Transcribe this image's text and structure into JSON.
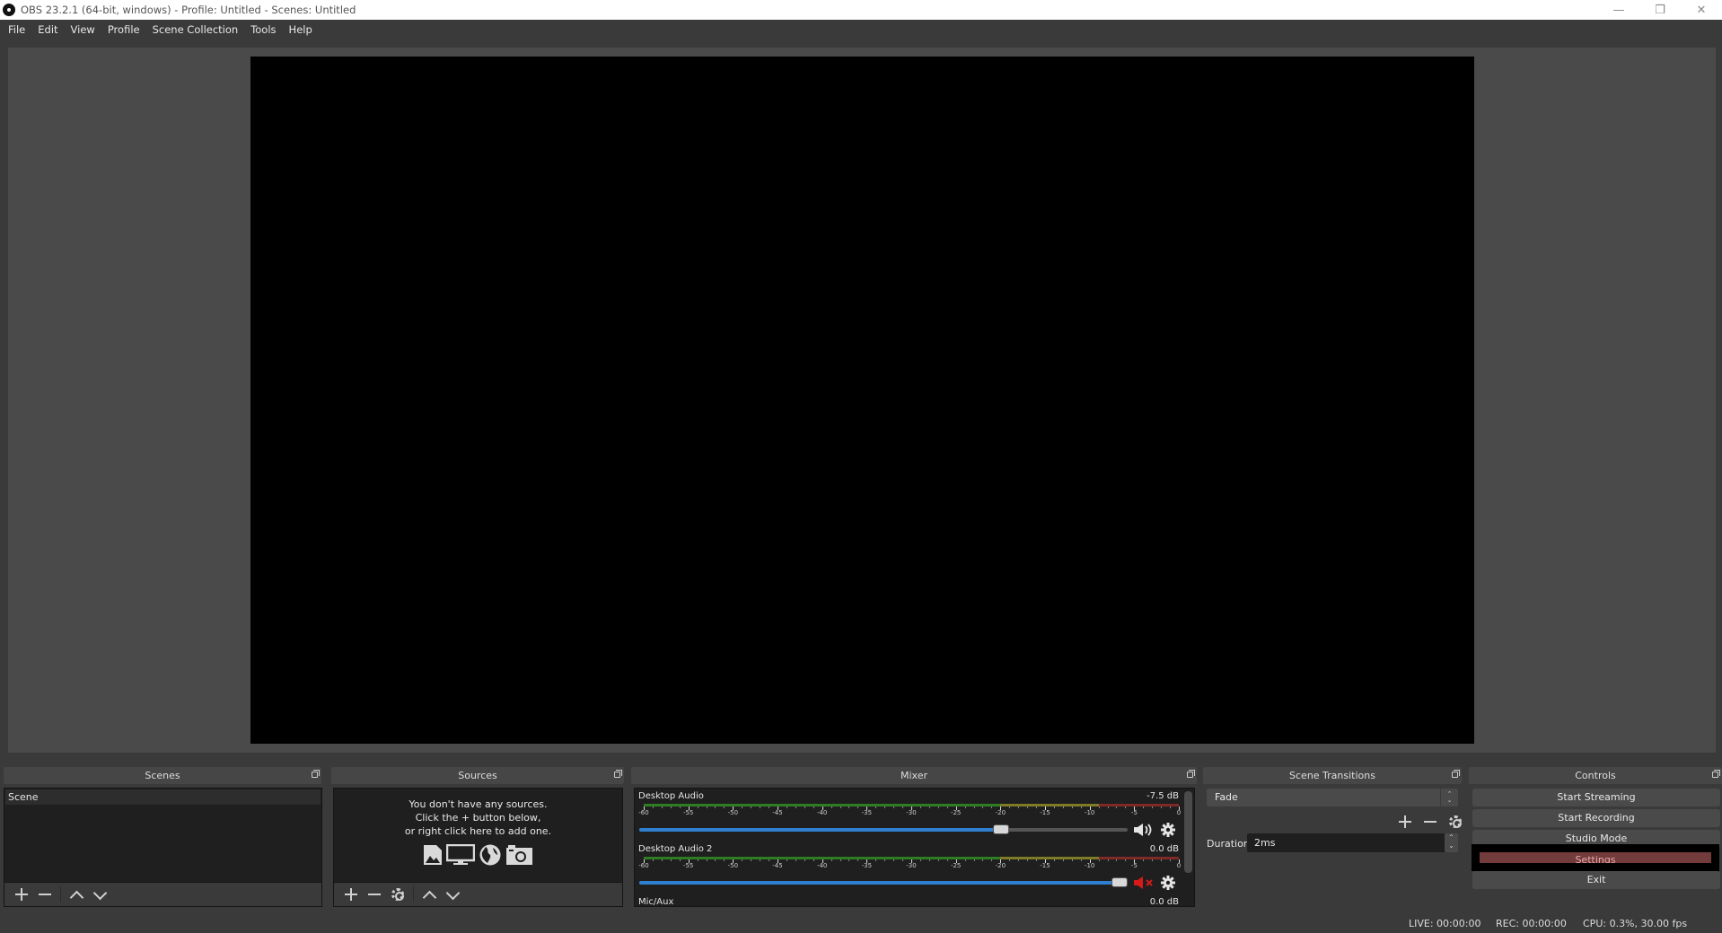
{
  "window": {
    "title": "OBS 23.2.1 (64-bit, windows) - Profile: Untitled - Scenes: Untitled",
    "controls": {
      "minimize": "—",
      "restore": "❐",
      "close": "✕"
    }
  },
  "menu": [
    "File",
    "Edit",
    "View",
    "Profile",
    "Scene Collection",
    "Tools",
    "Help"
  ],
  "docks": {
    "scenes": {
      "title": "Scenes",
      "items": [
        "Scene"
      ],
      "selected": "Scene"
    },
    "sources": {
      "title": "Sources",
      "empty_lines": [
        "You don't have any sources.",
        "Click the + button below,",
        "or right click here to add one."
      ],
      "icons": [
        "image-icon",
        "display-icon",
        "browser-globe-icon",
        "camera-icon"
      ]
    },
    "mixer": {
      "title": "Mixer",
      "scale_labels": [
        "-60",
        "-55",
        "-50",
        "-45",
        "-40",
        "-35",
        "-30",
        "-25",
        "-20",
        "-15",
        "-10",
        "-5",
        "0"
      ],
      "meter_colors": {
        "green": "#2e7d22",
        "yellow": "#7f7a26",
        "red": "#7f2a26"
      },
      "channels": [
        {
          "name": "Desktop Audio",
          "db": "-7.5 dB",
          "volume_db": -7.5,
          "muted": false
        },
        {
          "name": "Desktop Audio 2",
          "db": "0.0 dB",
          "volume_db": 0.0,
          "muted": true
        },
        {
          "name": "Mic/Aux",
          "db": "0.0 dB",
          "volume_db": 0.0,
          "muted": false
        }
      ]
    },
    "transitions": {
      "title": "Scene Transitions",
      "selected": "Fade",
      "duration_label": "Duration",
      "duration_value": "2ms"
    },
    "controls": {
      "title": "Controls",
      "buttons": [
        "Start Streaming",
        "Start Recording",
        "Studio Mode",
        "Settings",
        "Exit"
      ],
      "highlight_color": "#733c3c"
    }
  },
  "status": {
    "live": "LIVE: 00:00:00",
    "rec": "REC: 00:00:00",
    "cpu": "CPU: 0.3%, 30.00 fps"
  }
}
